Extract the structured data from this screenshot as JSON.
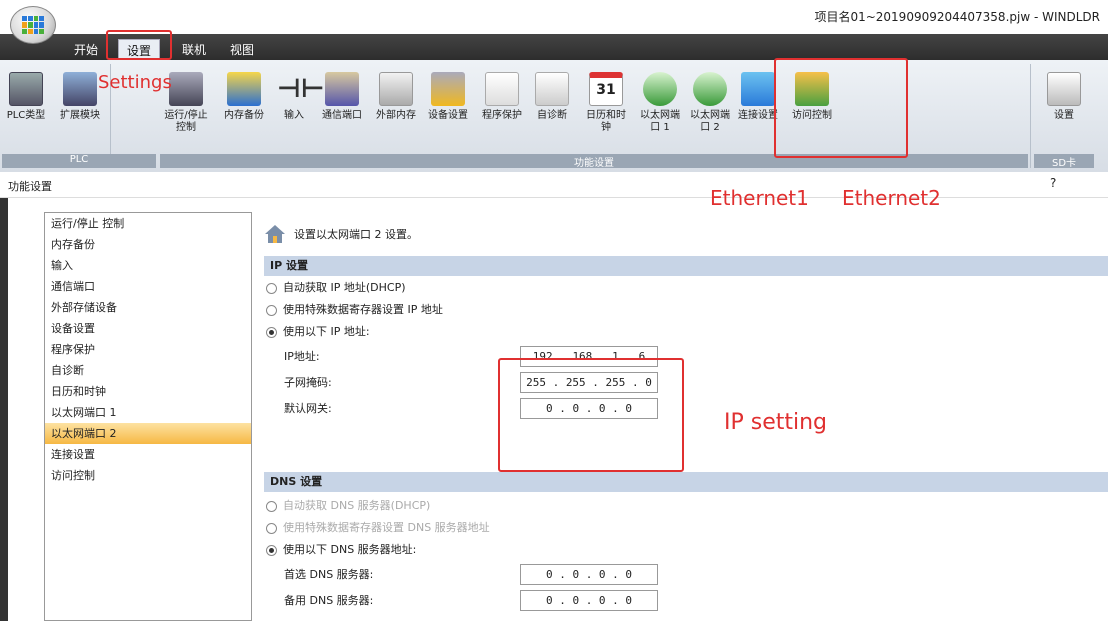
{
  "window": {
    "title": "项目名01~20190909204407358.pjw - WINDLDR"
  },
  "menu": {
    "tabs": [
      "开始",
      "设置",
      "联机",
      "视图"
    ],
    "active": "设置"
  },
  "ribbon": {
    "buttons": [
      "PLC类型",
      "扩展模块",
      "运行/停止 控制",
      "内存备份",
      "输入",
      "通信端口",
      "外部内存",
      "设备设置",
      "程序保护",
      "自诊断",
      "日历和时钟",
      "以太网端口 1",
      "以太网端口 2",
      "连接设置",
      "访问控制",
      "设置"
    ],
    "calendar_day": "31",
    "groups": [
      "PLC",
      "功能设置",
      "SD卡"
    ]
  },
  "panel": {
    "title": "功能设置",
    "help": "?"
  },
  "nav": {
    "items": [
      "运行/停止 控制",
      "内存备份",
      "输入",
      "通信端口",
      "外部存储设备",
      "设备设置",
      "程序保护",
      "自诊断",
      "日历和时钟",
      "以太网端口 1",
      "以太网端口 2",
      "连接设置",
      "访问控制"
    ],
    "selected": "以太网端口 2"
  },
  "content": {
    "hint": "设置以太网端口 2 设置。",
    "ip_section": {
      "title": "IP 设置",
      "opt_dhcp": "自动获取 IP 地址(DHCP)",
      "opt_special": "使用特殊数据寄存器设置 IP 地址",
      "opt_manual": "使用以下 IP 地址:",
      "selected": "opt_manual",
      "ip_label": "IP地址:",
      "ip_value": "192 . 168 . 1 . 6",
      "mask_label": "子网掩码:",
      "mask_value": "255 . 255 . 255 . 0",
      "gw_label": "默认网关:",
      "gw_value": "0 . 0 . 0 . 0"
    },
    "dns_section": {
      "title": "DNS 设置",
      "opt_dhcp": "自动获取 DNS 服务器(DHCP)",
      "opt_special": "使用特殊数据寄存器设置 DNS 服务器地址",
      "opt_manual": "使用以下 DNS 服务器地址:",
      "selected": "opt_manual",
      "primary_label": "首选 DNS 服务器:",
      "primary_value": "0 . 0 . 0 . 0",
      "secondary_label": "备用 DNS 服务器:",
      "secondary_value": "0 . 0 . 0 . 0"
    }
  },
  "annotations": {
    "settings": "Settings",
    "ethernet1": "Ethernet1",
    "ethernet2": "Ethernet2",
    "ip_setting": "IP setting",
    "color": "#e03030"
  }
}
